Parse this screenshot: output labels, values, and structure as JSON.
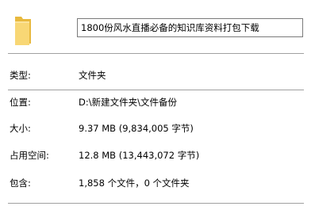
{
  "header": {
    "folder_icon": "folder-icon",
    "name_value": "1800份风水直播必备的知识库资料打包下载"
  },
  "properties": [
    {
      "label": "类型:",
      "value": "文件夹"
    },
    {
      "label": "位置:",
      "value": "D:\\新建文件夹\\文件备份"
    },
    {
      "label": "大小:",
      "value": "9.37 MB (9,834,005 字节)"
    },
    {
      "label": "占用空间:",
      "value": "12.8 MB (13,443,072 字节)"
    },
    {
      "label": "包含:",
      "value": "1,858 个文件，0 个文件夹"
    }
  ],
  "colors": {
    "folder_body": "#f8d775",
    "folder_back": "#e8b93e",
    "divider": "#a0a0a0",
    "input_border": "#7a7a7a"
  }
}
